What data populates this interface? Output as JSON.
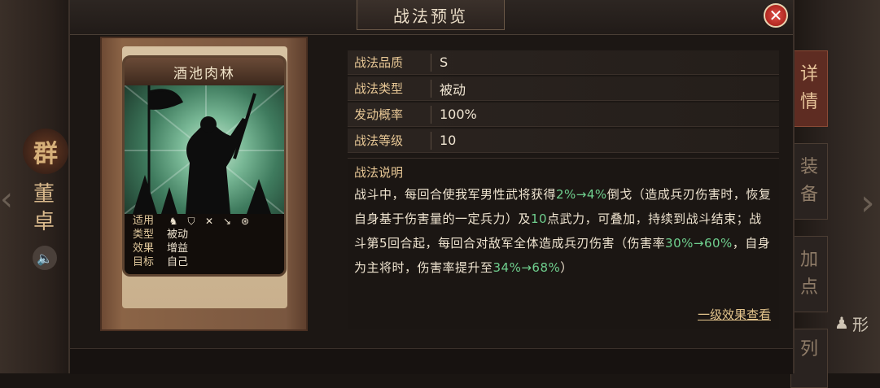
{
  "dialog": {
    "title": "战法预览",
    "close_icon": "close-icon"
  },
  "hero": {
    "faction": "群",
    "name": "董卓",
    "sound_icon": "speaker-icon"
  },
  "side_tabs": [
    {
      "label": "详情",
      "active": true
    },
    {
      "label": "装备",
      "active": false
    },
    {
      "label": "加点",
      "active": false
    },
    {
      "label": "列",
      "active": false
    }
  ],
  "right_hint": "形",
  "card": {
    "name": "酒池肉林",
    "info": {
      "arms_label": "适用",
      "arms_icons": [
        "cavalry-icon",
        "shield-icon",
        "bow-icon",
        "spear-icon",
        "ship-icon"
      ],
      "type_label": "类型",
      "type_value": "被动",
      "effect_label": "效果",
      "effect_value": "增益",
      "target_label": "目标",
      "target_value": "自己"
    }
  },
  "stats": [
    {
      "label": "战法品质",
      "value": "S"
    },
    {
      "label": "战法类型",
      "value": "被动"
    },
    {
      "label": "发动概率",
      "value": "100%"
    },
    {
      "label": "战法等级",
      "value": "10"
    }
  ],
  "description": {
    "title": "战法说明",
    "p1": "战斗中，每回合使我军男性武将获得",
    "h1": "2%→4%",
    "p2": "倒戈（造成兵刃伤害时，恢复自身基于伤害量的一定兵力）及",
    "h2": "10",
    "p3": "点武力，可叠加，持续到战斗结束；战斗第5回合起，每回合对敌军全体造成兵刃伤害（伤害率",
    "h3": "30%→60%",
    "p4": "，自身为主将时，伤害率提升至",
    "h4": "34%→68%",
    "p5": "）",
    "link": "一级效果查看"
  },
  "colors": {
    "highlight": "#6fcf8e",
    "label": "#e8c896",
    "close": "#b0271f"
  }
}
